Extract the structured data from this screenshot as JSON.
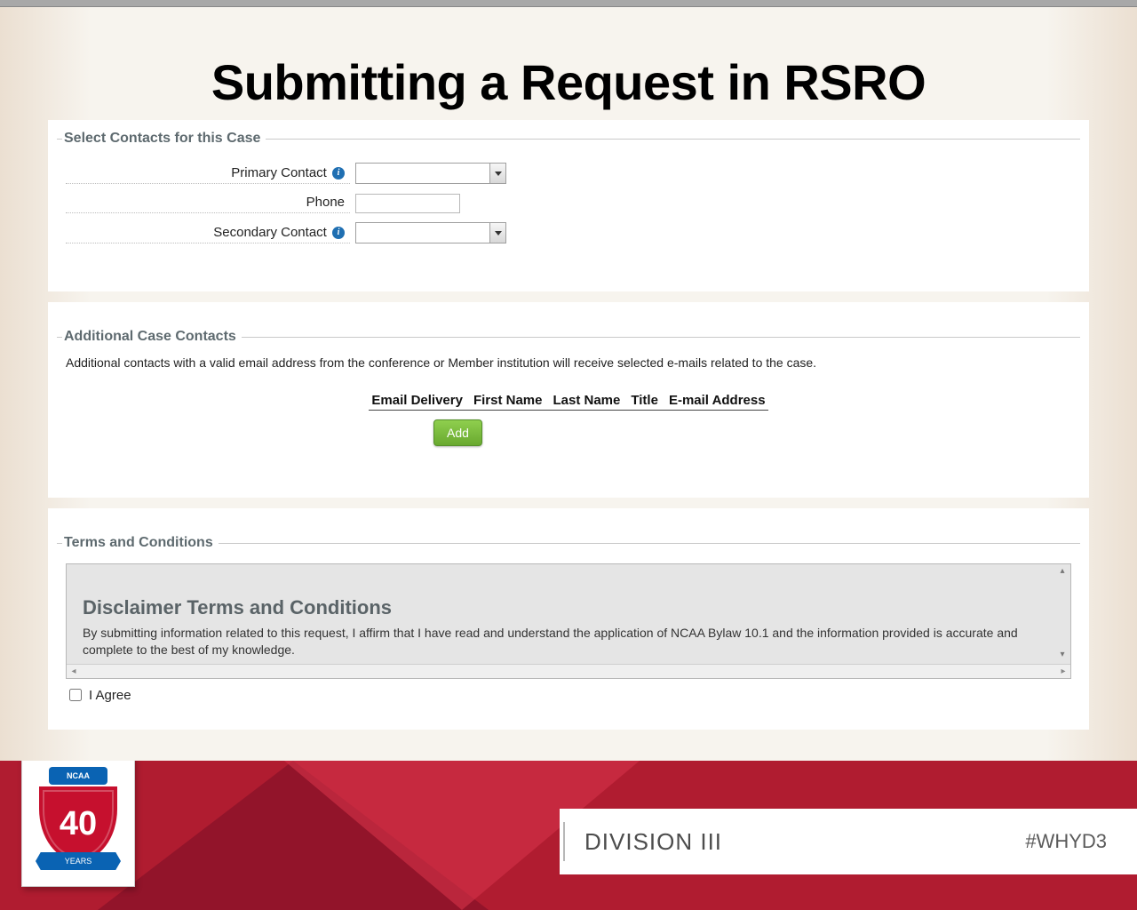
{
  "title": "Submitting a Request in RSRO",
  "contacts": {
    "legend": "Select Contacts for this Case",
    "primary_label": "Primary Contact",
    "primary_value": "",
    "phone_label": "Phone",
    "phone_value": "",
    "secondary_label": "Secondary Contact",
    "secondary_value": ""
  },
  "additional": {
    "legend": "Additional Case Contacts",
    "description": "Additional contacts with a valid email address from the conference or Member institution will receive selected e-mails related to the case.",
    "columns": {
      "c1": "Email Delivery",
      "c2": "First Name",
      "c3": "Last Name",
      "c4": "Title",
      "c5": "E-mail Address"
    },
    "add_label": "Add"
  },
  "terms": {
    "legend": "Terms and Conditions",
    "heading": "Disclaimer Terms and Conditions",
    "body": "By submitting information related to this request, I affirm that I have read and understand the application of NCAA Bylaw 10.1 and the information provided is accurate and complete to the best of my knowledge.",
    "agree_label": "I Agree"
  },
  "footer": {
    "badge_top": "NCAA",
    "badge_number": "40",
    "badge_ribbon": "YEARS",
    "division": "DIVISION III",
    "hashtag": "#WHYD3"
  }
}
